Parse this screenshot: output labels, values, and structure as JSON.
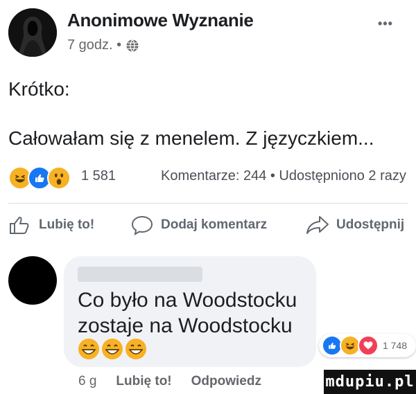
{
  "post": {
    "author": "Anonimowe Wyznanie",
    "time": "7 godz. •",
    "more_icon": "•••",
    "body_line1": "Krótko:",
    "body_line2": "Całowałam się z menelem. Z języczkiem...",
    "reactions_count": "1 581",
    "stats": "Komentarze: 244 • Udostępniono 2 razy",
    "actions": {
      "like": "Lubię to!",
      "comment": "Dodaj komentarz",
      "share": "Udostępnij"
    }
  },
  "comment": {
    "text": "Co było na Woodstocku\nzostaje na Woodstocku",
    "reactions_count": "1 748",
    "time": "6 g",
    "like_label": "Lubię to!",
    "reply_label": "Odpowiedz"
  },
  "watermark": "mdupiu.pl",
  "colors": {
    "accent_blue": "#1877f2",
    "reaction_yellow": "#f7b125",
    "love_red": "#f33e58"
  },
  "icons": [
    "globe-icon",
    "more-icon",
    "like-icon",
    "comment-icon",
    "share-icon",
    "laugh-reaction-icon",
    "wow-reaction-icon",
    "love-reaction-icon"
  ]
}
